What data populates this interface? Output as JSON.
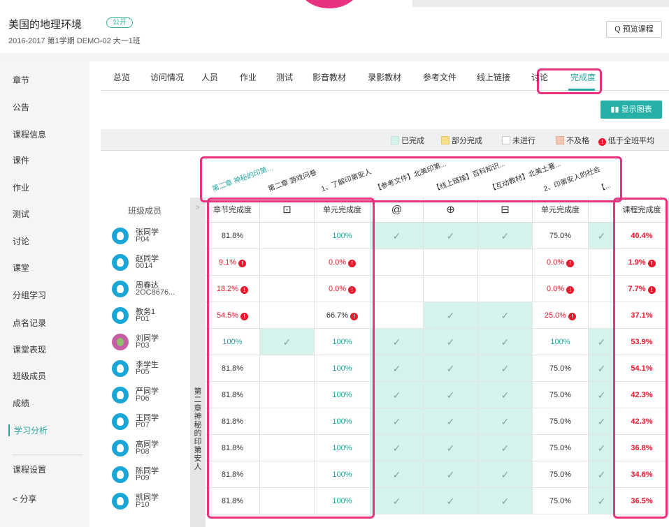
{
  "header": {
    "title": "美国的地理环境",
    "badge": "公开",
    "subtitle": "2016-2017 第1学期 DEMO-02 大一1班",
    "preview_button": "Q 预览课程"
  },
  "sidebar": {
    "items": [
      {
        "label": "章节"
      },
      {
        "label": "公告"
      },
      {
        "label": "课程信息"
      },
      {
        "label": "课件"
      },
      {
        "label": "作业"
      },
      {
        "label": "测试"
      },
      {
        "label": "讨论"
      },
      {
        "label": "课堂"
      },
      {
        "label": "分组学习"
      },
      {
        "label": "点名记录"
      },
      {
        "label": "课堂表现"
      },
      {
        "label": "班级成员"
      },
      {
        "label": "成绩"
      },
      {
        "label": "学习分析",
        "active": true
      },
      {
        "label": "课程设置"
      },
      {
        "label": "< 分享"
      }
    ]
  },
  "tabs": [
    {
      "label": "总览"
    },
    {
      "label": "访问情况"
    },
    {
      "label": "人员"
    },
    {
      "label": "作业"
    },
    {
      "label": "测试"
    },
    {
      "label": "影音教材"
    },
    {
      "label": "录影教材"
    },
    {
      "label": "参考文件"
    },
    {
      "label": "线上链接"
    },
    {
      "label": "讨论"
    },
    {
      "label": "完成度",
      "active": true
    }
  ],
  "toolbar": {
    "chart_button": "显示图表"
  },
  "legend": {
    "completed": "已完成",
    "partial": "部分完成",
    "not_started": "未进行",
    "failed": "不及格",
    "below_avg": "低于全班平均",
    "colors": {
      "completed": "#d6f2ec",
      "partial": "#f7dc8a",
      "not_started": "#ffffff",
      "failed": "#f3c6b3",
      "alert": "#e8192c",
      "accent": "#2aa6a0",
      "highlight": "#e8327f"
    }
  },
  "diag_headers": [
    "第二章 神秘的印第...",
    "第二章 游戏问卷",
    "1、了解印第安人",
    "【参考文件】北美印第...",
    "【线上链接】百科知识...",
    "【互动教材】北美土著...",
    "2、印第安人的社会",
    "【..."
  ],
  "table": {
    "member_column_label": "班级成员",
    "chapter_label": "第二章 神秘的印第安人",
    "columns": [
      {
        "label": "章节完成度",
        "icon": ""
      },
      {
        "label": "",
        "icon": "video-icon"
      },
      {
        "label": "单元完成度",
        "icon": ""
      },
      {
        "label": "",
        "icon": "attachment-icon"
      },
      {
        "label": "",
        "icon": "globe-icon"
      },
      {
        "label": "",
        "icon": "interactive-icon"
      },
      {
        "label": "单元完成度",
        "icon": ""
      },
      {
        "label": "",
        "icon": ""
      },
      {
        "label": "课程完成度",
        "icon": ""
      }
    ],
    "rows": [
      {
        "name": "张同学",
        "id": "P04",
        "chapter": "81.8%",
        "chapter_alert": false,
        "video": false,
        "unit1": "100%",
        "unit1_alert": false,
        "ref": true,
        "link": true,
        "interactive": true,
        "unit2": "75.0%",
        "unit2_alert": false,
        "extra": true,
        "total": "40.4%",
        "total_alert": false
      },
      {
        "name": "赵同学",
        "id": "0014",
        "chapter": "9.1%",
        "chapter_alert": true,
        "video": false,
        "unit1": "0.0%",
        "unit1_alert": true,
        "ref": false,
        "link": false,
        "interactive": false,
        "unit2": "0.0%",
        "unit2_alert": true,
        "extra": false,
        "total": "1.9%",
        "total_alert": true
      },
      {
        "name": "周春达",
        "id": "2OC8676...",
        "chapter": "18.2%",
        "chapter_alert": true,
        "video": false,
        "unit1": "0.0%",
        "unit1_alert": true,
        "ref": false,
        "link": false,
        "interactive": false,
        "unit2": "0.0%",
        "unit2_alert": true,
        "extra": false,
        "total": "7.7%",
        "total_alert": true
      },
      {
        "name": "教务1",
        "id": "P01",
        "chapter": "54.5%",
        "chapter_alert": true,
        "video": false,
        "unit1": "66.7%",
        "unit1_alert": true,
        "ref": false,
        "link": true,
        "interactive": true,
        "unit2": "25.0%",
        "unit2_alert": true,
        "extra": false,
        "total": "37.1%",
        "total_alert": false
      },
      {
        "name": "刘同学",
        "id": "P03",
        "photo": true,
        "chapter": "100%",
        "chapter_alert": false,
        "video": true,
        "unit1": "100%",
        "unit1_alert": false,
        "ref": true,
        "link": true,
        "interactive": true,
        "unit2": "100%",
        "unit2_alert": false,
        "extra": true,
        "total": "53.9%",
        "total_alert": false
      },
      {
        "name": "李学生",
        "id": "P05",
        "chapter": "81.8%",
        "chapter_alert": false,
        "video": false,
        "unit1": "100%",
        "unit1_alert": false,
        "ref": true,
        "link": true,
        "interactive": true,
        "unit2": "75.0%",
        "unit2_alert": false,
        "extra": true,
        "total": "54.1%",
        "total_alert": false
      },
      {
        "name": "严同学",
        "id": "P06",
        "chapter": "81.8%",
        "chapter_alert": false,
        "video": false,
        "unit1": "100%",
        "unit1_alert": false,
        "ref": true,
        "link": true,
        "interactive": true,
        "unit2": "75.0%",
        "unit2_alert": false,
        "extra": true,
        "total": "42.3%",
        "total_alert": false
      },
      {
        "name": "王同学",
        "id": "P07",
        "chapter": "81.8%",
        "chapter_alert": false,
        "video": false,
        "unit1": "100%",
        "unit1_alert": false,
        "ref": true,
        "link": true,
        "interactive": true,
        "unit2": "75.0%",
        "unit2_alert": false,
        "extra": true,
        "total": "42.3%",
        "total_alert": false
      },
      {
        "name": "高同学",
        "id": "P08",
        "chapter": "81.8%",
        "chapter_alert": false,
        "video": false,
        "unit1": "100%",
        "unit1_alert": false,
        "ref": true,
        "link": true,
        "interactive": true,
        "unit2": "75.0%",
        "unit2_alert": false,
        "extra": true,
        "total": "36.8%",
        "total_alert": false
      },
      {
        "name": "陈同学",
        "id": "P09",
        "chapter": "81.8%",
        "chapter_alert": false,
        "video": false,
        "unit1": "100%",
        "unit1_alert": false,
        "ref": true,
        "link": true,
        "interactive": true,
        "unit2": "75.0%",
        "unit2_alert": false,
        "extra": true,
        "total": "34.6%",
        "total_alert": false
      },
      {
        "name": "凯同学",
        "id": "P10",
        "chapter": "81.8%",
        "chapter_alert": false,
        "video": false,
        "unit1": "100%",
        "unit1_alert": false,
        "ref": true,
        "link": true,
        "interactive": true,
        "unit2": "75.0%",
        "unit2_alert": false,
        "extra": true,
        "total": "36.5%",
        "total_alert": false
      }
    ]
  }
}
